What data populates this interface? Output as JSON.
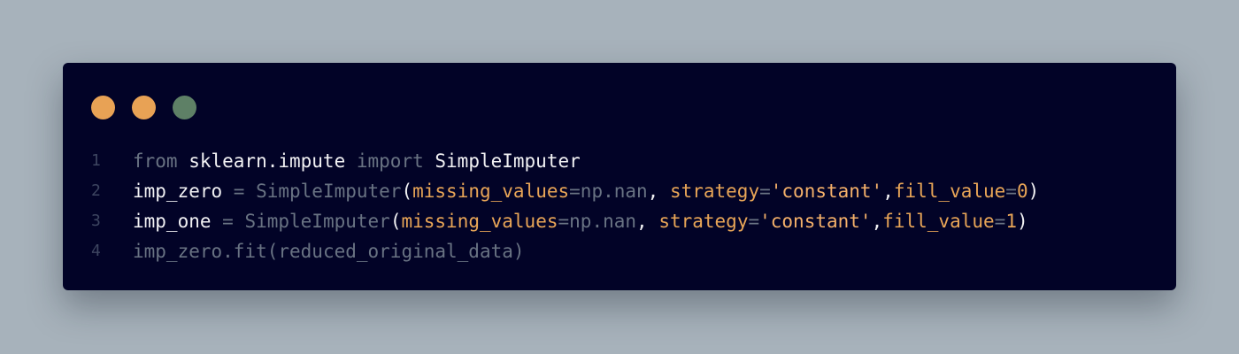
{
  "window": {
    "controls": [
      {
        "name": "close",
        "color": "#e8a255"
      },
      {
        "name": "minimize",
        "color": "#e8a255"
      },
      {
        "name": "maximize",
        "color": "#5e8066"
      }
    ]
  },
  "code": {
    "lines": [
      {
        "number": "1",
        "tokens": [
          {
            "text": "from ",
            "kind": "kw"
          },
          {
            "text": "sklearn.impute ",
            "kind": "bright"
          },
          {
            "text": "import ",
            "kind": "kw"
          },
          {
            "text": "SimpleImputer",
            "kind": "bright"
          }
        ]
      },
      {
        "number": "2",
        "tokens": [
          {
            "text": "imp_zero ",
            "kind": "bright"
          },
          {
            "text": "= ",
            "kind": "op"
          },
          {
            "text": "SimpleImputer",
            "kind": "cls"
          },
          {
            "text": "(",
            "kind": "punc"
          },
          {
            "text": "missing_values",
            "kind": "arg"
          },
          {
            "text": "=",
            "kind": "op"
          },
          {
            "text": "np.nan",
            "kind": "plain"
          },
          {
            "text": ", ",
            "kind": "punc"
          },
          {
            "text": "strategy",
            "kind": "arg"
          },
          {
            "text": "=",
            "kind": "op"
          },
          {
            "text": "'constant'",
            "kind": "str"
          },
          {
            "text": ",",
            "kind": "punc"
          },
          {
            "text": "fill_value",
            "kind": "arg"
          },
          {
            "text": "=",
            "kind": "op"
          },
          {
            "text": "0",
            "kind": "arg"
          },
          {
            "text": ")",
            "kind": "punc"
          }
        ]
      },
      {
        "number": "3",
        "tokens": [
          {
            "text": "imp_one ",
            "kind": "bright"
          },
          {
            "text": "= ",
            "kind": "op"
          },
          {
            "text": "SimpleImputer",
            "kind": "cls"
          },
          {
            "text": "(",
            "kind": "punc"
          },
          {
            "text": "missing_values",
            "kind": "arg"
          },
          {
            "text": "=",
            "kind": "op"
          },
          {
            "text": "np.nan",
            "kind": "plain"
          },
          {
            "text": ", ",
            "kind": "punc"
          },
          {
            "text": "strategy",
            "kind": "arg"
          },
          {
            "text": "=",
            "kind": "op"
          },
          {
            "text": "'constant'",
            "kind": "str"
          },
          {
            "text": ",",
            "kind": "punc"
          },
          {
            "text": "fill_value",
            "kind": "arg"
          },
          {
            "text": "=",
            "kind": "op"
          },
          {
            "text": "1",
            "kind": "arg"
          },
          {
            "text": ")",
            "kind": "punc"
          }
        ]
      },
      {
        "number": "4",
        "tokens": [
          {
            "text": "imp_zero.fit",
            "kind": "plain"
          },
          {
            "text": "(",
            "kind": "plain"
          },
          {
            "text": "reduced_original_data",
            "kind": "plain"
          },
          {
            "text": ")",
            "kind": "plain"
          }
        ]
      }
    ]
  }
}
